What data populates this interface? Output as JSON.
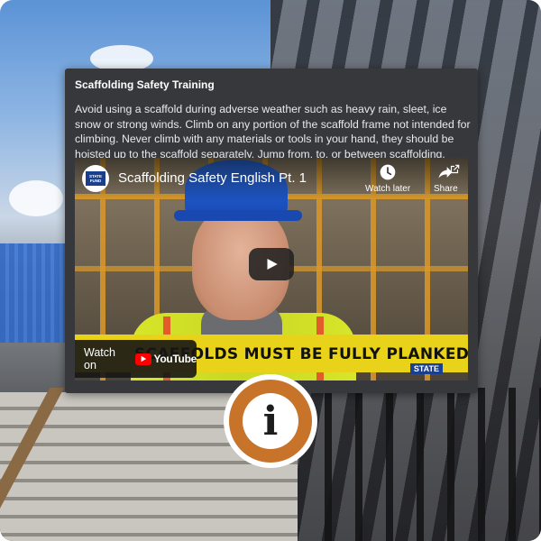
{
  "infobox": {
    "title": "Scaffolding Safety Training",
    "body": "Avoid using a scaffold during adverse weather such as heavy rain, sleet, ice snow or strong winds. Climb on any portion of the scaffold frame not intended for climbing. Never climb with any materials or tools in your hand, they should be hoisted up to the scaffold separately. Jump from, to, or between scaffolding."
  },
  "video": {
    "channel_logo_text": "STATE FUND",
    "title": "Scaffolding Safety English Pt. 1",
    "watch_later_label": "Watch later",
    "share_label": "Share",
    "caption": "SCAFFOLDS MUST BE FULLY PLANKED",
    "watermark": "STATE",
    "watch_on_label": "Watch on",
    "youtube_label": "YouTube"
  },
  "marker": {
    "symbol": "i"
  },
  "colors": {
    "card_bg": "#36383b",
    "marker_orange": "#c7742a",
    "youtube_red": "#ff0000",
    "caption_yellow": "#e8d21a"
  },
  "icons": {
    "watch_later": "clock-icon",
    "share": "share-icon",
    "external": "external-link-icon",
    "play": "play-icon",
    "info": "info-icon"
  }
}
